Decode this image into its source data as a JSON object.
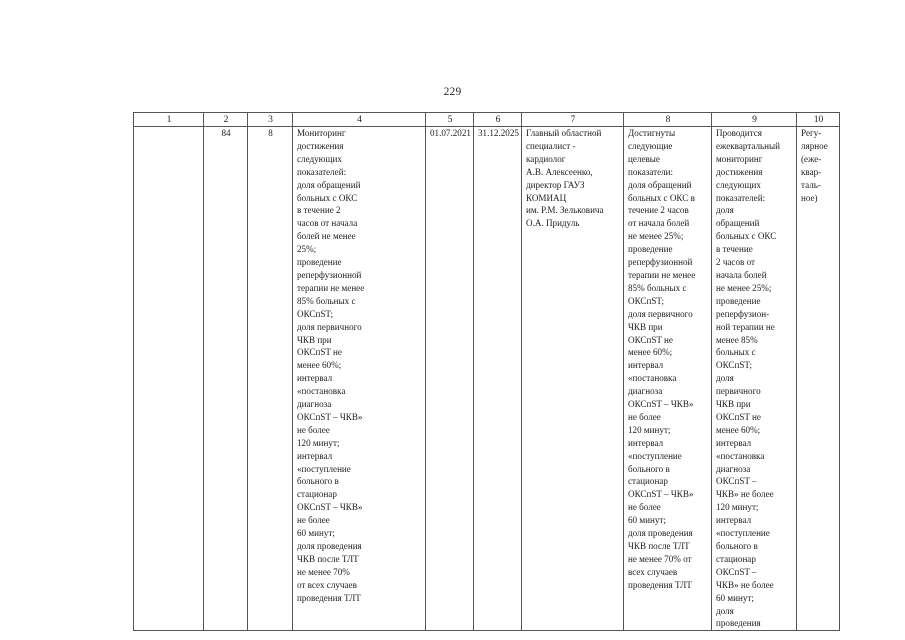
{
  "document": {
    "page_number": "229"
  },
  "table": {
    "column_headers": [
      "1",
      "2",
      "3",
      "4",
      "5",
      "6",
      "7",
      "8",
      "9",
      "10"
    ],
    "rows": [
      {
        "col1": [],
        "col2": [
          "84"
        ],
        "col3": [
          "8"
        ],
        "col4": [
          "Мониторинг",
          "достижения",
          "следующих",
          "показателей:",
          "доля обращений",
          "больных с ОКС",
          "в течение 2",
          "часов от начала",
          "болей не менее",
          "25%;",
          "проведение",
          "реперфузионной",
          "терапии не менее",
          "85% больных с",
          "ОКСпST;",
          "доля первичного",
          "ЧКВ при",
          "ОКСпST не",
          "менее 60%;",
          "интервал",
          "«постановка",
          "диагноза",
          "ОКСпST – ЧКВ»",
          "не более",
          "120 минут;",
          "интервал",
          "«поступление",
          "больного в",
          "стационар",
          "ОКСпST – ЧКВ»",
          "не более",
          "60 минут;",
          "доля проведения",
          "ЧКВ после ТЛТ",
          "не менее 70%",
          "от всех случаев",
          "проведения ТЛТ"
        ],
        "col5": [
          "01.07.2021"
        ],
        "col6": [
          "31.12.2025"
        ],
        "col7": [
          "Главный областной",
          "специалист -",
          "кардиолог",
          "А.В. Алексеенко,",
          "директор ГАУЗ",
          "КОМИАЦ",
          "им. Р.М. Зельковича",
          "О.А. Придуль"
        ],
        "col8": [
          "Достигнуты",
          "следующие",
          "целевые",
          "показатели:",
          "доля обращений",
          "больных с ОКС в",
          "течение 2 часов",
          "от начала болей",
          "не менее 25%;",
          "проведение",
          "реперфузионной",
          "терапии не менее",
          "85% больных с",
          "ОКСпST;",
          "доля первичного",
          "ЧКВ при",
          "ОКСпST не",
          "менее 60%;",
          "интервал",
          "«постановка",
          "диагноза",
          "ОКСпST – ЧКВ»",
          "не более",
          "120 минут;",
          "интервал",
          "«поступление",
          "больного в",
          "стационар",
          "ОКСпST – ЧКВ»",
          "не более",
          "60 минут;",
          "доля проведения",
          "ЧКВ после ТЛТ",
          "не менее 70% от",
          "всех случаев",
          "проведения ТЛТ"
        ],
        "col9": [
          "Проводится",
          "ежеквартальный",
          "мониторинг",
          "достижения",
          "следующих",
          "показателей:",
          "доля",
          "обращений",
          "больных с ОКС",
          "в течение",
          "2 часов от",
          "начала болей",
          "не менее 25%;",
          "проведение",
          "реперфузион-",
          "ной терапии не",
          "менее 85%",
          "больных с",
          "ОКСпST;",
          "доля",
          "первичного",
          "ЧКВ при",
          "ОКСпST не",
          "менее 60%;",
          "интервал",
          "«постановка",
          "диагноза",
          "ОКСпST –",
          "ЧКВ» не более",
          "120 минут;",
          "интервал",
          "«поступление",
          "больного в",
          "стационар",
          "ОКСпST –",
          "ЧКВ» не более",
          "60 минут;",
          "доля",
          "проведения"
        ],
        "col10": [
          "Регу-",
          "лярное",
          "(еже-",
          "квар-",
          "таль-",
          "ное)"
        ]
      }
    ]
  }
}
